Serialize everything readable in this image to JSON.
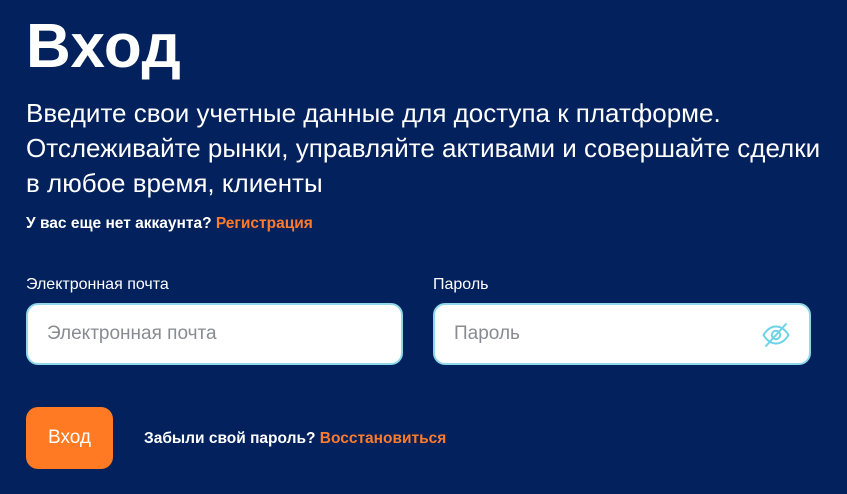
{
  "login": {
    "title": "Вход",
    "subtitle": "Введите свои учетные данные для доступа к платформе. Отслеживайте рынки, управляйте активами и совершайте сделки в любое время, клиенты",
    "register_prompt": "У вас еще нет аккаунта?",
    "register_link": "Регистрация",
    "email_label": "Электронная почта",
    "email_placeholder": "Электронная почта",
    "email_value": "",
    "password_label": "Пароль",
    "password_placeholder": "Пароль",
    "password_value": "",
    "password_toggle_icon": "eye-slash-icon",
    "submit_label": "Вход",
    "forgot_prompt": "Забыли свой пароль?",
    "forgot_link": "Восстановиться"
  },
  "colors": {
    "background": "#03215c",
    "accent": "#ff7a22",
    "field_border": "#8fd8e8",
    "icon": "#6fd3e8"
  }
}
